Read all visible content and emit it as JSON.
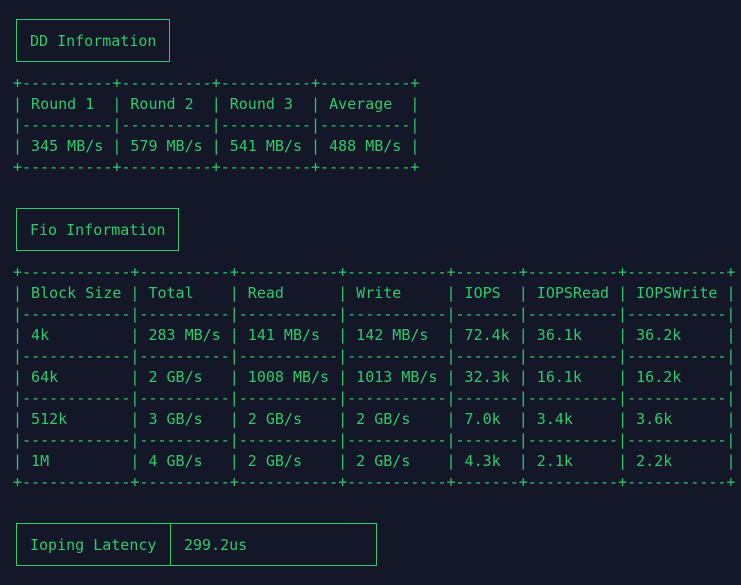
{
  "dd": {
    "title": "DD Information",
    "headers": [
      "Round 1",
      "Round 2",
      "Round 3",
      "Average"
    ],
    "rows": [
      [
        "345 MB/s",
        "579 MB/s",
        "541 MB/s",
        "488 MB/s"
      ]
    ]
  },
  "fio": {
    "title": "Fio Information",
    "headers": [
      "Block Size",
      "Total",
      "Read",
      "Write",
      "IOPS",
      "IOPSRead",
      "IOPSWrite"
    ],
    "rows": [
      [
        "4k",
        "283 MB/s",
        "141 MB/s",
        "142 MB/s",
        "72.4k",
        "36.1k",
        "36.2k"
      ],
      [
        "64k",
        "2 GB/s",
        "1008 MB/s",
        "1013 MB/s",
        "32.3k",
        "16.1k",
        "16.2k"
      ],
      [
        "512k",
        "3 GB/s",
        "2 GB/s",
        "2 GB/s",
        "7.0k",
        "3.4k",
        "3.6k"
      ],
      [
        "1M",
        "4 GB/s",
        "2 GB/s",
        "2 GB/s",
        "4.3k",
        "2.1k",
        "2.2k"
      ]
    ]
  },
  "ioping": {
    "label": "Ioping Latency",
    "value": "299.2us"
  }
}
